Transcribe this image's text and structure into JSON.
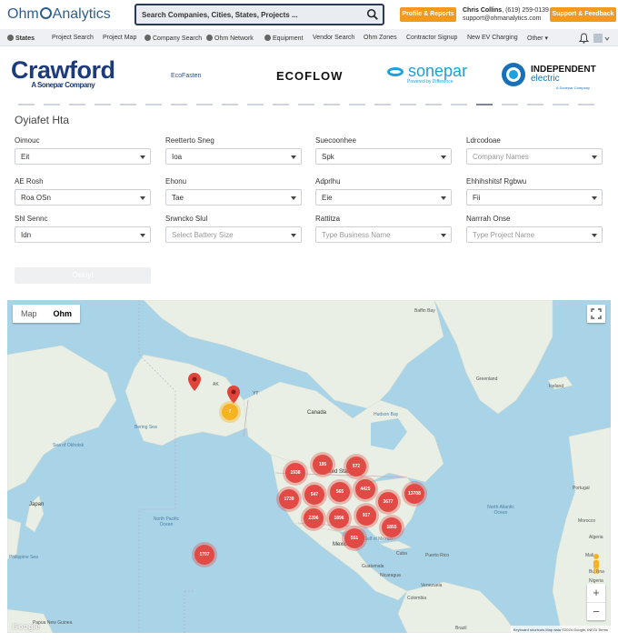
{
  "header": {
    "logo_text_left": "Ohm",
    "logo_text_right": "Analytics",
    "search_placeholder": "Search Companies, Cities, States, Projects ...",
    "profile_button": "Profile & Reports",
    "user_name": "Chris Collins",
    "user_phone": ", (619) 259-0139",
    "user_email": "support@ohmanalytics.com",
    "support_button": "Support & Feedback"
  },
  "nav": {
    "items": [
      "States",
      "Project Search",
      "Project Map",
      "Company Search",
      "Ohm Network",
      "Equipment",
      "Vendor Search",
      "Ohm Zones",
      "Contractor Signup",
      "New EV Charging",
      "Other"
    ]
  },
  "brands": {
    "crawford": "Crawford",
    "crawford_sub": "A Sonepar Company",
    "ecofasten": "EcoFasten",
    "ecoflow": "ECOFLOW",
    "sonepar": "sonepar",
    "sonepar_sub": "Powered by Difference",
    "independent_1": "INDEPENDENT",
    "independent_2": "electric",
    "independent_3": "A Sonepar Company"
  },
  "form": {
    "title": "Oyiafet Hta",
    "fields": [
      {
        "label": "Oimouc",
        "value": "Eit"
      },
      {
        "label": "Reetterto Sneg",
        "value": "Ioa"
      },
      {
        "label": "Suecoonhee",
        "value": "Spk"
      },
      {
        "label": "Ldrcodoae",
        "value": "Company Names"
      },
      {
        "label": "AE Rosh",
        "value": "Roa OSn"
      },
      {
        "label": "Ehonu",
        "value": "Tae"
      },
      {
        "label": "Adprlhu",
        "value": "Eie"
      },
      {
        "label": "Ehhihshitsf Rgbwu",
        "value": "Fii"
      },
      {
        "label": "Shl Sennc",
        "value": "Idn"
      },
      {
        "label": "Srwncko Slul",
        "value": "Select Battery Size"
      },
      {
        "label": "Rattitza",
        "value": "Type Business Name"
      },
      {
        "label": "Narrrah Onse",
        "value": "Type Project Name"
      }
    ],
    "submit": "Oeloyt"
  },
  "map": {
    "tab_map": "Map",
    "tab_active": "Ohm",
    "labels": {
      "baffin": "Baffin Bay",
      "greenland": "Greenland",
      "iceland": "Iceland",
      "canada": "Canada",
      "hudson": "Hudson Bay",
      "ak": "AK",
      "yt": "YT",
      "bering": "Bering Sea",
      "okhotsk": "Sea of Okhotsk",
      "japan": "Japan",
      "npo": "North Pacific Ocean",
      "nao": "North Atlantic Ocean",
      "mexico": "Mexico",
      "gulf": "Gulf of Mexico",
      "cuba": "Cuba",
      "pr": "Puerto Rico",
      "guat": "Guatemala",
      "nic": "Nicaragua",
      "ven": "Venezuela",
      "col": "Colombia",
      "brazil": "Brazil",
      "portugal": "Portugal",
      "morocco": "Morocco",
      "algeria": "Algeria",
      "mali": "Mali",
      "phil": "Philippine Sea",
      "guinea": "Papua New Guinea",
      "burkina": "Burkina",
      "nigeria": "Nigeria",
      "us": "United States"
    },
    "clusters": [
      "195",
      "572",
      "1938",
      "4425",
      "547",
      "565",
      "13708",
      "3677",
      "1739",
      "2396",
      "1896",
      "917",
      "1855",
      "551",
      "1707"
    ],
    "yellow_cluster": "7",
    "attribution": "Keyboard shortcuts   Map data ©2024 Google, INEGI   Terms",
    "google": "Google"
  },
  "colors": {
    "accent": "#f39a1e",
    "brand": "#2f5f8f",
    "cluster": "#e24a45",
    "water": "#a9d3e6",
    "land": "#e9efe4"
  }
}
